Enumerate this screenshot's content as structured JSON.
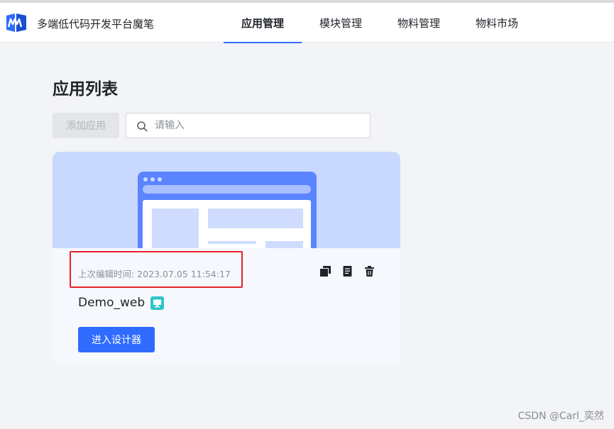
{
  "header": {
    "brand": "多端低代码开发平台魔笔",
    "nav": [
      {
        "label": "应用管理",
        "active": true
      },
      {
        "label": "模块管理",
        "active": false
      },
      {
        "label": "物料管理",
        "active": false
      },
      {
        "label": "物料市场",
        "active": false
      }
    ]
  },
  "main": {
    "title": "应用列表",
    "add_button": "添加应用",
    "search": {
      "placeholder": "请输入",
      "value": ""
    }
  },
  "apps": [
    {
      "last_edited": "上次编辑时间: 2023.07.05 11:54:17",
      "name": "Demo_web",
      "enter_button": "进入设计器"
    }
  ],
  "watermark": "CSDN @Carl_奕然",
  "colors": {
    "accent": "#2f6bff",
    "banner": "#c9d8ff",
    "highlight": "#e8232b",
    "platform_badge": "#2ec4c9"
  },
  "icons": {
    "logo": "mobi-logo",
    "search": "search-icon",
    "copy": "copy-icon",
    "document": "document-icon",
    "delete": "trash-icon",
    "platform": "monitor-icon"
  }
}
